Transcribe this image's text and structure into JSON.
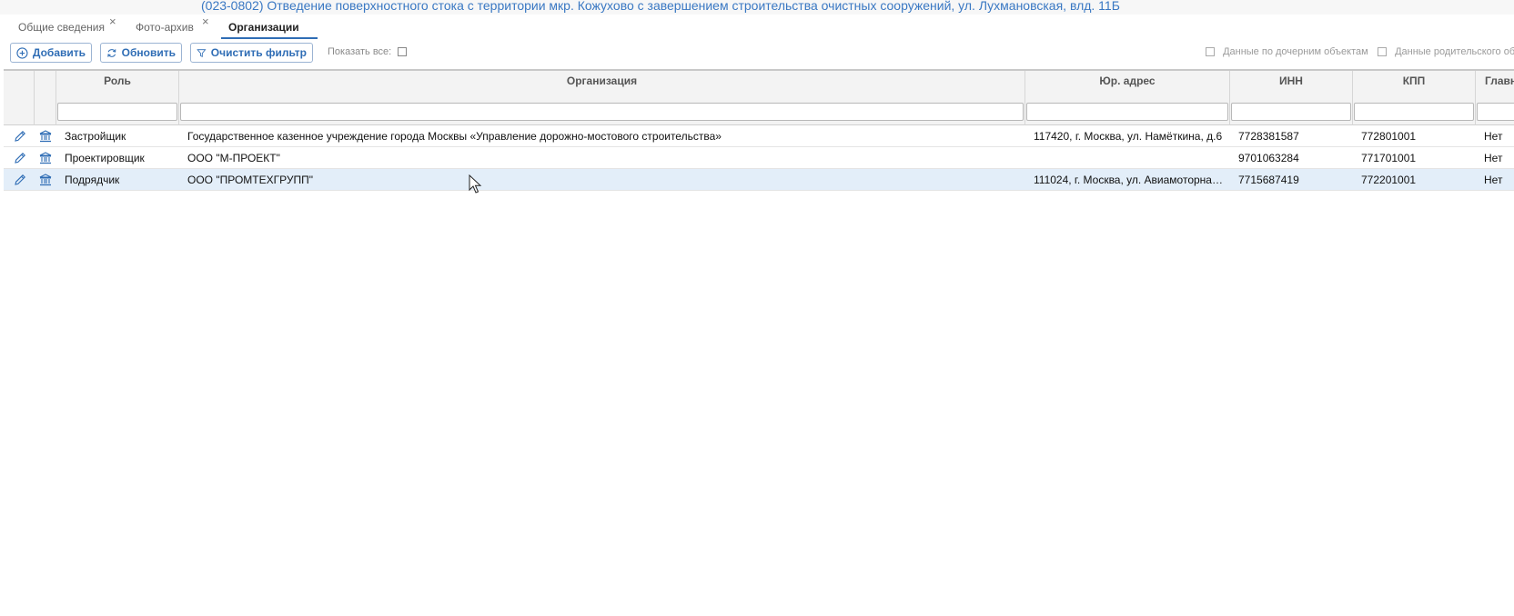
{
  "header": {
    "title": "(023-0802) Отведение поверхностного стока с территории мкр. Кожухово с завершением строительства очистных сооружений, ул. Лухмановская, влд. 11Б"
  },
  "tabs": [
    {
      "label": "Общие сведения",
      "closable": true,
      "active": false
    },
    {
      "label": "Фото-архив",
      "closable": true,
      "active": false
    },
    {
      "label": "Организации",
      "closable": false,
      "active": true
    }
  ],
  "toolbar": {
    "add_label": "Добавить",
    "refresh_label": "Обновить",
    "clear_filter_label": "Очистить фильтр",
    "show_all_label": "Показать все:",
    "child_data_label": "Данные по дочерним объектам",
    "parent_data_label": "Данные родительского объ"
  },
  "table": {
    "columns": [
      "Роль",
      "Организация",
      "Юр. адрес",
      "ИНН",
      "КПП",
      "Главн"
    ],
    "rows": [
      {
        "role": "Застройщик",
        "org": "Государственное казенное учреждение города Москвы «Управление дорожно-мостового строительства»",
        "address": "117420, г. Москва, ул. Намёткина, д.6",
        "inn": "7728381587",
        "kpp": "772801001",
        "main": "Нет"
      },
      {
        "role": "Проектировщик",
        "org": "ООО \"М-ПРОЕКТ\"",
        "address": "",
        "inn": "9701063284",
        "kpp": "771701001",
        "main": "Нет"
      },
      {
        "role": "Подрядчик",
        "org": "ООО \"ПРОМТЕХГРУПП\"",
        "address": "111024, г. Москва, ул. Авиамоторна…",
        "inn": "7715687419",
        "kpp": "772201001",
        "main": "Нет"
      }
    ],
    "selected_row": 2
  },
  "colors": {
    "accent": "#2f6db5",
    "title": "#3a78c3",
    "selected_row": "#e3eef9"
  },
  "icons": [
    "close-icon",
    "add-icon",
    "refresh-icon",
    "filter-icon",
    "edit-pencil-icon",
    "organization-building-icon",
    "mouse-cursor-icon"
  ]
}
